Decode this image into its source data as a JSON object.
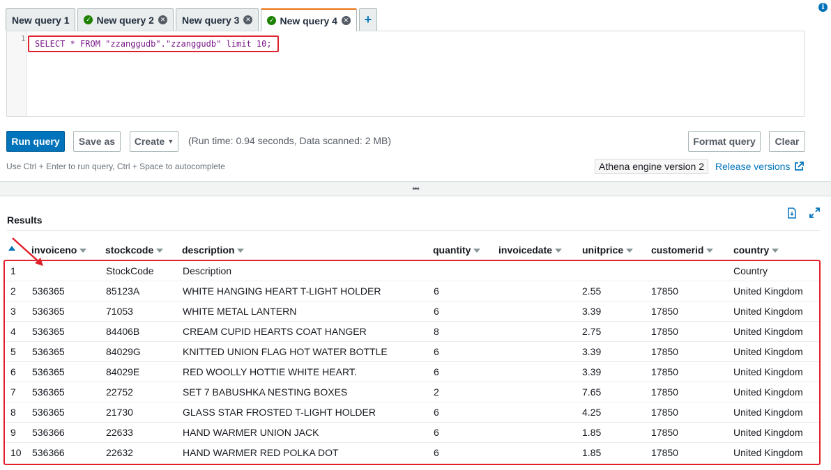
{
  "tabs": [
    {
      "label": "New query 1",
      "status": "none",
      "closable": false,
      "active": false
    },
    {
      "label": "New query 2",
      "status": "ok",
      "closable": true,
      "active": false
    },
    {
      "label": "New query 3",
      "status": "none",
      "closable": true,
      "active": false
    },
    {
      "label": "New query 4",
      "status": "ok",
      "closable": true,
      "active": true
    }
  ],
  "add_tab_label": "+",
  "editor": {
    "line_number": "1",
    "sql": "SELECT * FROM \"zzanggudb\".\"zzanggudb\" limit 10;"
  },
  "toolbar": {
    "run_label": "Run query",
    "save_label": "Save as",
    "create_label": "Create",
    "run_info": "(Run time: 0.94 seconds, Data scanned: 2 MB)",
    "format_label": "Format query",
    "clear_label": "Clear",
    "hint": "Use Ctrl + Enter to run query, Ctrl + Space to autocomplete",
    "engine": "Athena engine version 2",
    "release_label": "Release versions"
  },
  "splitter_label": "•••",
  "results": {
    "title": "Results",
    "columns": [
      "invoiceno",
      "stockcode",
      "description",
      "quantity",
      "invoicedate",
      "unitprice",
      "customerid",
      "country"
    ],
    "rows": [
      [
        "1",
        "",
        "StockCode",
        "Description",
        "",
        "",
        "",
        "",
        "Country"
      ],
      [
        "2",
        "536365",
        "85123A",
        "WHITE HANGING HEART T-LIGHT HOLDER",
        "6",
        "",
        "2.55",
        "17850",
        "United Kingdom"
      ],
      [
        "3",
        "536365",
        "71053",
        "WHITE METAL LANTERN",
        "6",
        "",
        "3.39",
        "17850",
        "United Kingdom"
      ],
      [
        "4",
        "536365",
        "84406B",
        "CREAM CUPID HEARTS COAT HANGER",
        "8",
        "",
        "2.75",
        "17850",
        "United Kingdom"
      ],
      [
        "5",
        "536365",
        "84029G",
        "KNITTED UNION FLAG HOT WATER BOTTLE",
        "6",
        "",
        "3.39",
        "17850",
        "United Kingdom"
      ],
      [
        "6",
        "536365",
        "84029E",
        "RED WOOLLY HOTTIE WHITE HEART.",
        "6",
        "",
        "3.39",
        "17850",
        "United Kingdom"
      ],
      [
        "7",
        "536365",
        "22752",
        "SET 7 BABUSHKA NESTING BOXES",
        "2",
        "",
        "7.65",
        "17850",
        "United Kingdom"
      ],
      [
        "8",
        "536365",
        "21730",
        "GLASS STAR FROSTED T-LIGHT HOLDER",
        "6",
        "",
        "4.25",
        "17850",
        "United Kingdom"
      ],
      [
        "9",
        "536366",
        "22633",
        "HAND WARMER UNION JACK",
        "6",
        "",
        "1.85",
        "17850",
        "United Kingdom"
      ],
      [
        "10",
        "536366",
        "22632",
        "HAND WARMER RED POLKA DOT",
        "6",
        "",
        "1.85",
        "17850",
        "United Kingdom"
      ]
    ]
  },
  "colors": {
    "primary": "#0073bb",
    "highlight_border": "#e0202a",
    "active_tab": "#ec7211",
    "success": "#1d8102"
  }
}
